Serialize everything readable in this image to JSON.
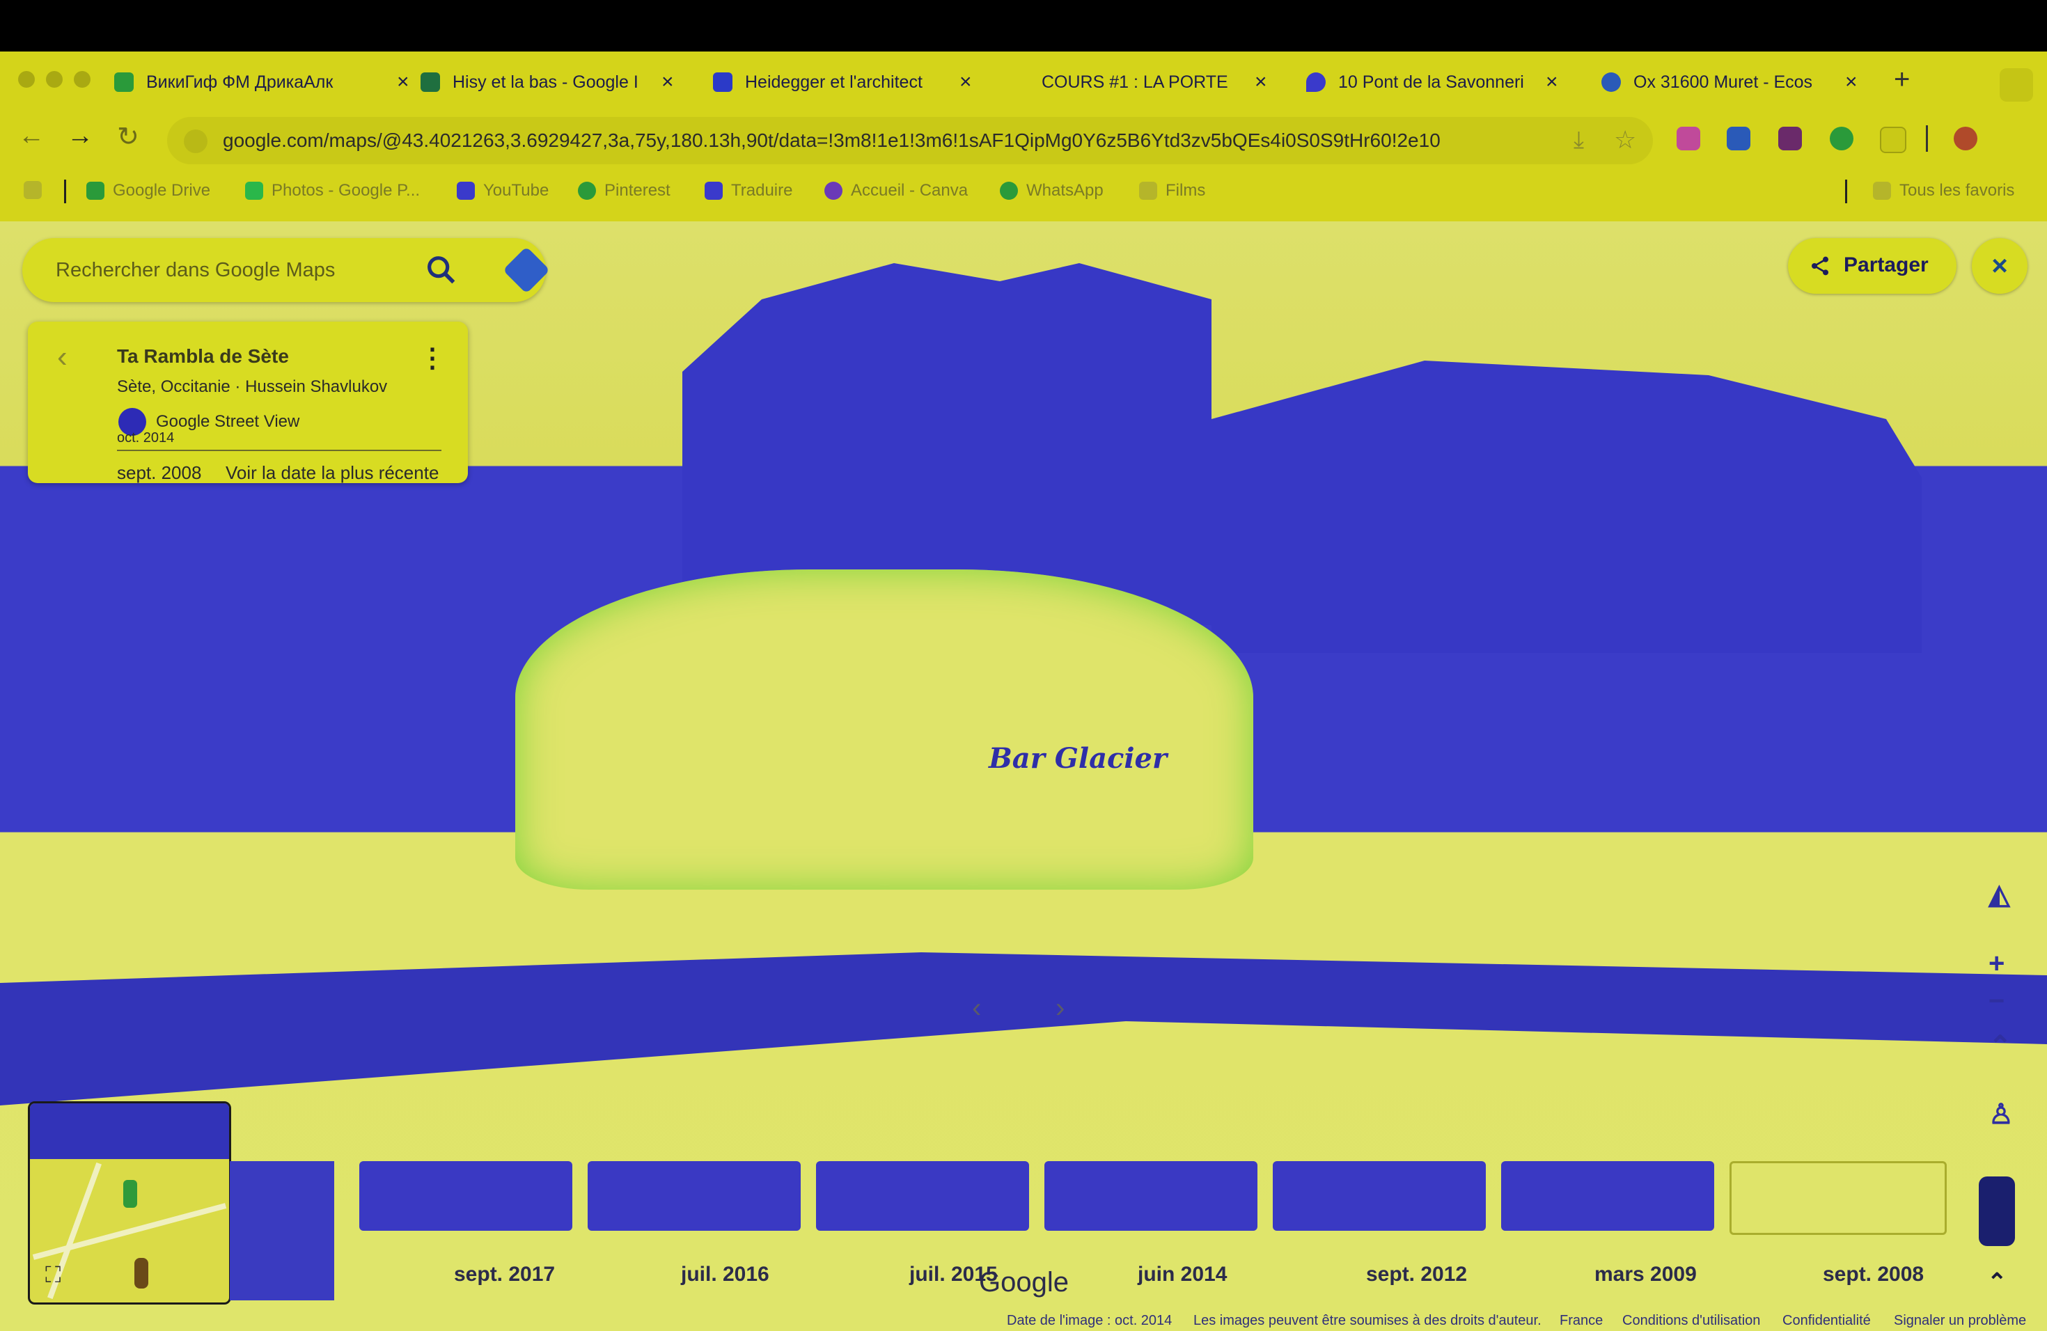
{
  "tabs": [
    {
      "label": "ВикиГиф ФМ ДрикаАлк",
      "active": true,
      "fav": "#2a9a3a"
    },
    {
      "label": "Hisy et la bas - Google I",
      "active": false,
      "fav": "#1f6f3f"
    },
    {
      "label": "Heidegger et l'architect",
      "active": false,
      "fav": "#2b3ac8"
    },
    {
      "label": "COURS #1 : LA PORTE",
      "active": false,
      "fav": ""
    },
    {
      "label": "10 Pont de la Savonneri",
      "active": false,
      "fav": "#3a3acb"
    },
    {
      "label": "Ox 31600 Muret - Ecos",
      "active": false,
      "fav": "#2a5ab8"
    }
  ],
  "tab_close": "×",
  "new_tab": "+",
  "url": "google.com/maps/@43.4021263,3.6929427,3a,75y,180.13h,90t/data=!3m8!1e1!3m6!1sAF1QipMg0Y6z5B6Ytd3zv5bQEs4i0S0S9tHr60!2e10",
  "bookmarks": [
    {
      "label": "Google Drive",
      "color": "#2a9a3a"
    },
    {
      "label": "Photos - Google P...",
      "color": "#2ab74a"
    },
    {
      "label": "YouTube",
      "color": "#3a3acb"
    },
    {
      "label": "Pinterest",
      "color": "#2a9a3a"
    },
    {
      "label": "Traduire",
      "color": "#3a3acb"
    },
    {
      "label": "Accueil - Canva",
      "color": "#6a3ab8"
    },
    {
      "label": "WhatsApp",
      "color": "#2a9a3a"
    },
    {
      "label": "Films",
      "color": "#b5b52a"
    }
  ],
  "all_bookmarks": "Tous les favoris",
  "search": {
    "placeholder": "Rechercher dans Google Maps"
  },
  "info": {
    "title": "Ta Rambla de Sète",
    "author": "Sète, Occitanie · Hussein Shavlukov",
    "source": "Google Street View",
    "old_date": "oct. 2014",
    "date": "sept. 2008",
    "latest_link": "Voir la date la plus récente"
  },
  "share_label": "Partager",
  "close_label": "×",
  "controls": {
    "zoom_in": "+",
    "zoom_out": "−",
    "prev": "‹",
    "next": "›",
    "up": "⌃"
  },
  "timeline": [
    {
      "date": "sept. 2017",
      "selected": false
    },
    {
      "date": "juil. 2016",
      "selected": false
    },
    {
      "date": "juil. 2015",
      "selected": false
    },
    {
      "date": "juin 2014",
      "selected": false
    },
    {
      "date": "sept. 2012",
      "selected": false
    },
    {
      "date": "mars 2009",
      "selected": false
    },
    {
      "date": "sept. 2008",
      "selected": true
    }
  ],
  "google_logo": "Google",
  "footer": {
    "image_date": "Date de l'image : oct. 2014",
    "imagery": "Les images peuvent être soumises à des droits d'auteur.",
    "france": "France",
    "terms": "Conditions d'utilisation",
    "privacy": "Confidentialité",
    "report": "Signaler un problème"
  },
  "sign_text": "Bar Glacier"
}
